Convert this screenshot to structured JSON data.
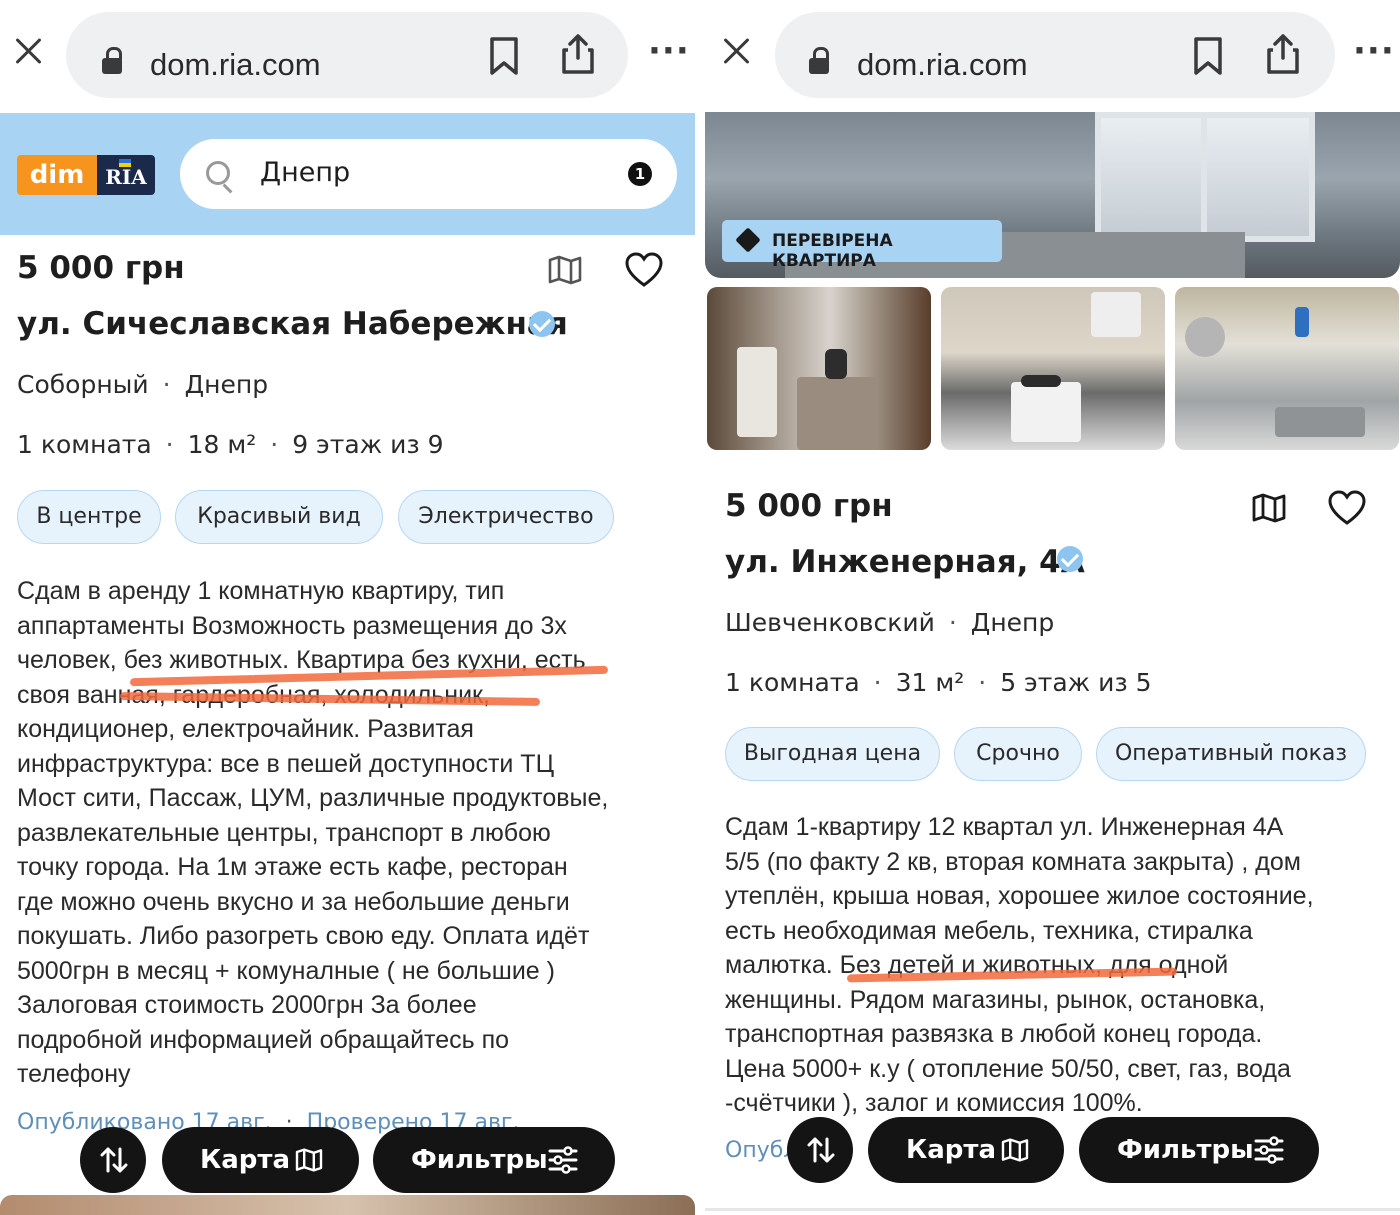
{
  "browser": {
    "url": "dom.ria.com"
  },
  "left": {
    "logo": {
      "dim": "dim",
      "ria": "RIA"
    },
    "search": {
      "value": "Днепр",
      "badge": "1"
    },
    "price": "5 000 грн",
    "street": "ул. Сичеславская Набережная",
    "district": "Соборный",
    "city": "Днепр",
    "rooms": "1 комната",
    "area": "18 м²",
    "floor": "9 этаж из 9",
    "tags": [
      "В центре",
      "Красивый вид",
      "Электричество"
    ],
    "description": [
      "Сдам в аренду 1 комнатную квартиру, тип",
      "аппартаменты Возможность размещения до 3х",
      "человек, без животных. Квартира без кухни, есть",
      "своя ванная, гардеробная, холодильник,",
      "кондиционер, електрочайник. Развитая",
      "инфраструктура: все в пешей доступности ТЦ",
      "Мост сити, Пассаж, ЦУМ, различные продуктовые,",
      "развлекательные центры, транспорт в любою",
      "точку города. На 1м этаже есть кафе, ресторан",
      "где можно очень вкусно и за небольшие деньги",
      "покушать. Либо разогреть свою еду. Оплата идёт",
      "5000грн в месяц + комуналные ( не большие )",
      "Залоговая стоимость 2000грн За более",
      "подробной информацией обращайтесь по",
      "телефону"
    ],
    "published": "Опубликовано 17 авг.",
    "checked": "Проверено 17 авг.",
    "buttons": {
      "map": "Карта",
      "filters": "Фильтры"
    }
  },
  "right": {
    "verified_badge": "ПЕРЕВІРЕНА КВАРТИРА",
    "price": "5 000 грн",
    "street": "ул. Инженерная, 4А",
    "district": "Шевченковский",
    "city": "Днепр",
    "rooms": "1 комната",
    "area": "31 м²",
    "floor": "5 этаж из 5",
    "tags": [
      "Выгодная цена",
      "Срочно",
      "Оперативный показ"
    ],
    "description": [
      "Сдам 1-квартиру 12 квартал ул. Инженерная 4А",
      "5/5 (по факту 2 кв, вторая комната закрыта) , дом",
      "утеплён, крыша новая, хорошее жилое состояние,",
      "есть необходимая мебель, техника, стиралка",
      "малютка. Без детей и животных, для одной",
      "женщины. Рядом магазины, рынок, остановка,",
      "транспортная развязка в любой конец города.",
      "Цена 5000+ к.у ( отопление 50/50, свет, газ, вода",
      "-счётчики ), залог и комиссия 100%."
    ],
    "published": "Опубл",
    "buttons": {
      "map": "Карта",
      "filters": "Фильтры"
    }
  },
  "colors": {
    "header_blue": "#a8d3f2",
    "tag_bg": "#e6f2fc",
    "logo_orange": "#f7941d",
    "underline_red": "#f26a3d",
    "verified_blue": "#8ec5f0",
    "fab_black": "#141414"
  }
}
